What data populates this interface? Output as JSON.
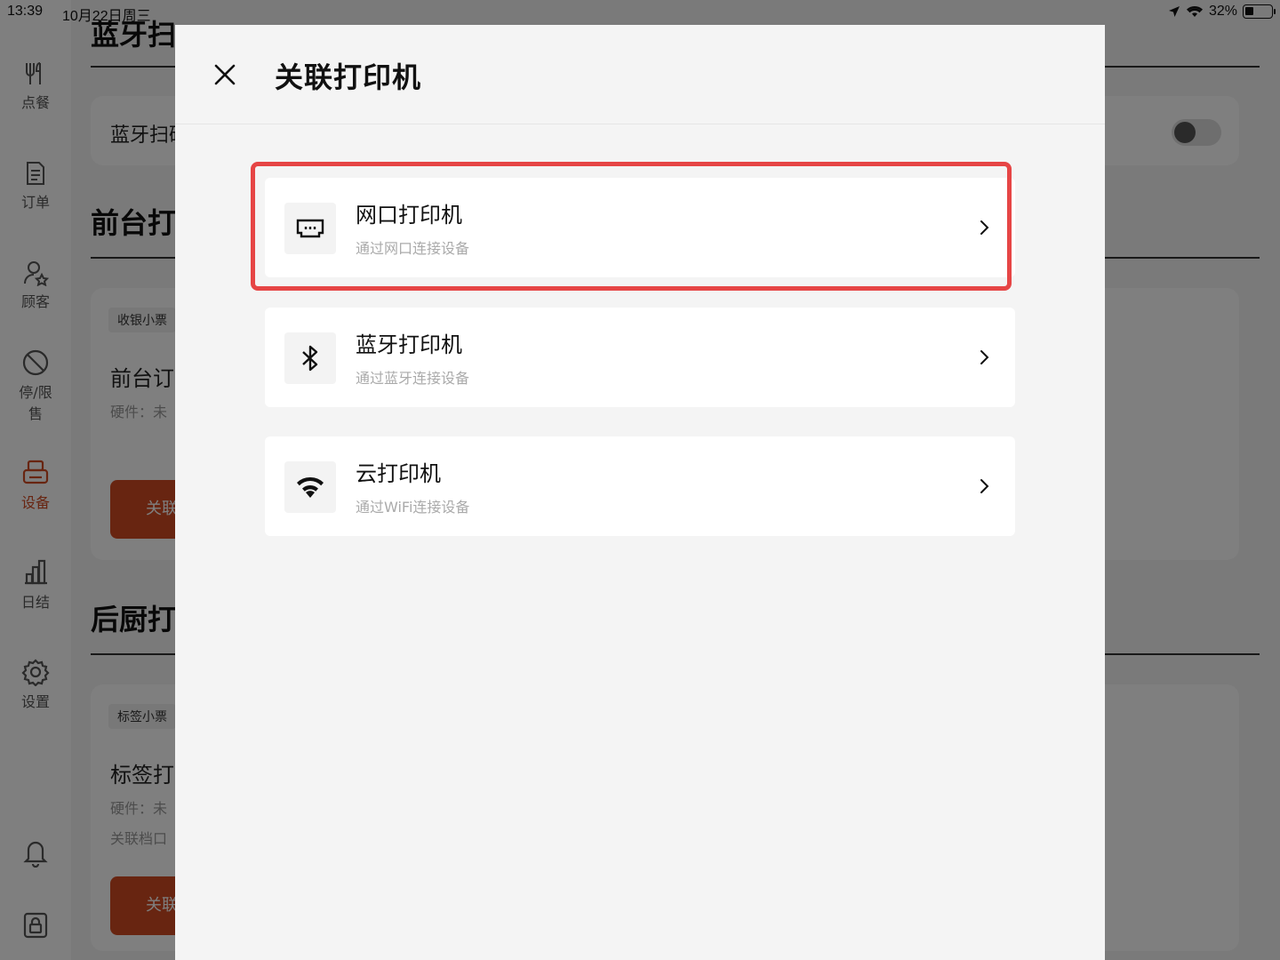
{
  "status_bar": {
    "time": "13:39",
    "date": "10月22日周三",
    "battery": "32%"
  },
  "sidebar": {
    "items": [
      {
        "label": "点餐",
        "icon": "dining-icon"
      },
      {
        "label": "订单",
        "icon": "order-doc-icon"
      },
      {
        "label": "顾客",
        "icon": "customer-icon"
      },
      {
        "label": "停/限",
        "label2": "售",
        "icon": "ban-icon"
      },
      {
        "label": "设备",
        "icon": "printer-icon",
        "active": true
      },
      {
        "label": "日结",
        "icon": "chart-icon"
      },
      {
        "label": "设置",
        "icon": "gear-icon"
      }
    ],
    "accent": "#d14a22"
  },
  "background": {
    "section_top_title": "蓝牙扫",
    "bt_scan_label": "蓝牙扫码",
    "front_title": "前台打",
    "front_card": {
      "tag": "收银小票",
      "title": "前台订",
      "hardware": "硬件：未",
      "button": "关联"
    },
    "kitchen_title": "后厨打",
    "kitchen_card": {
      "tag": "标签小票",
      "title": "标签打",
      "hardware": "硬件：未",
      "port": "关联档口",
      "button": "关联"
    }
  },
  "modal": {
    "title": "关联打印机",
    "options": [
      {
        "title": "网口打印机",
        "subtitle": "通过网口连接设备",
        "icon": "ethernet-port-icon",
        "highlighted": true
      },
      {
        "title": "蓝牙打印机",
        "subtitle": "通过蓝牙连接设备",
        "icon": "bluetooth-icon"
      },
      {
        "title": "云打印机",
        "subtitle": "通过WiFi连接设备",
        "icon": "wifi-icon"
      }
    ],
    "highlight_color": "#e64545"
  }
}
